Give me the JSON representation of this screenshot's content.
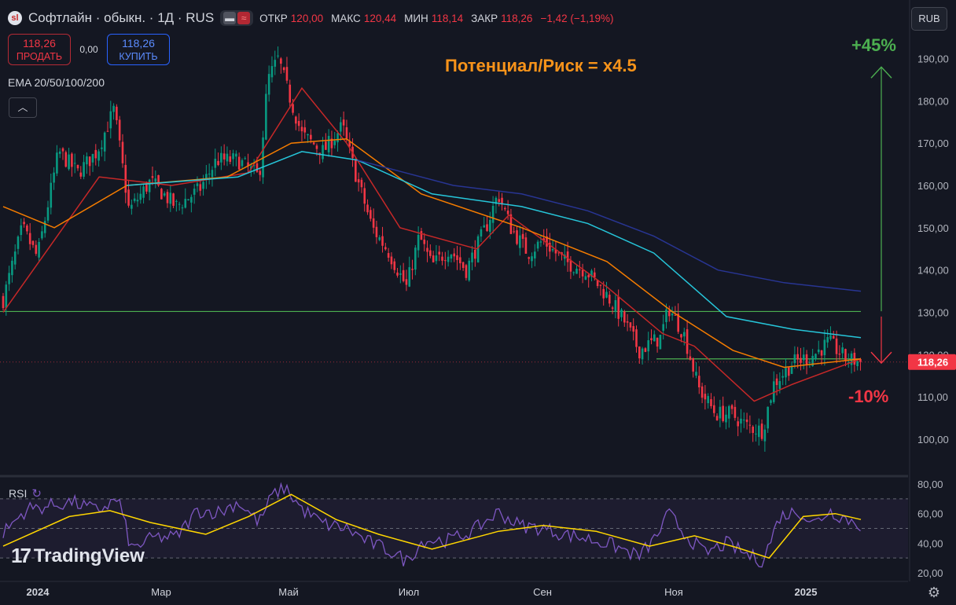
{
  "header": {
    "logo_text": "sl",
    "symbol": "Софтлайн · обыкн. · 1Д · RUS",
    "ohlc": [
      {
        "label": "ОТКР",
        "value": "120,00"
      },
      {
        "label": "МАКС",
        "value": "120,44"
      },
      {
        "label": "МИН",
        "value": "118,14"
      },
      {
        "label": "ЗАКР",
        "value": "118,26"
      },
      {
        "label": "",
        "value": "−1,42 (−1,19%)"
      }
    ],
    "currency": "RUB"
  },
  "trade": {
    "sell_price": "118,26",
    "sell_label": "ПРОДАТЬ",
    "spread": "0,00",
    "buy_price": "118,26",
    "buy_label": "КУПИТЬ"
  },
  "indicators": {
    "ema_label": "EMA 20/50/100/200",
    "rsi_label": "RSI"
  },
  "annotations": {
    "ratio": "Потенциал/Риск = x4.5",
    "upside": "+45%",
    "downside": "-10%"
  },
  "branding": {
    "name": "TradingView"
  },
  "colors": {
    "bg": "#141722",
    "up": "#089981",
    "down": "#f23645",
    "ema20": "#c62828",
    "ema50": "#f57c00",
    "ema100": "#26c6da",
    "ema200": "#283593",
    "level": "#4caf50",
    "rsi": "#7e57c2",
    "rsi_ma": "#ffd600",
    "annotation": "#f7931a"
  },
  "chart_data": {
    "type": "candlestick",
    "title": "Софтлайн · обыкн. · 1Д · RUS",
    "x_tick_labels": [
      "2024",
      "Мар",
      "Май",
      "Июл",
      "Сен",
      "Ноя",
      "2025"
    ],
    "y_tick_labels": [
      "190,00",
      "180,00",
      "170,00",
      "160,00",
      "150,00",
      "140,00",
      "130,00",
      "120,00",
      "110,00",
      "100,00"
    ],
    "ylim": [
      97,
      196
    ],
    "last_price": 118.26,
    "last_price_label": "118,26",
    "levels": [
      {
        "name": "resistance",
        "value": 130.2
      },
      {
        "name": "support",
        "value": 119.0
      }
    ],
    "targets": {
      "upside_arrow_to": 188,
      "downside_arrow_to": 118
    },
    "price_path": [
      [
        "2024-01-01",
        133
      ],
      [
        "2024-01-10",
        150
      ],
      [
        "2024-01-17",
        143
      ],
      [
        "2024-01-27",
        168
      ],
      [
        "2024-02-05",
        163
      ],
      [
        "2024-02-14",
        168
      ],
      [
        "2024-02-22",
        178
      ],
      [
        "2024-02-29",
        154
      ],
      [
        "2024-03-10",
        161
      ],
      [
        "2024-03-22",
        155
      ],
      [
        "2024-04-02",
        159
      ],
      [
        "2024-04-10",
        166
      ],
      [
        "2024-04-20",
        166
      ],
      [
        "2024-04-30",
        162
      ],
      [
        "2024-05-04",
        185
      ],
      [
        "2024-05-09",
        190
      ],
      [
        "2024-05-13",
        183
      ],
      [
        "2024-05-20",
        172
      ],
      [
        "2024-05-30",
        168
      ],
      [
        "2024-06-08",
        174
      ],
      [
        "2024-06-14",
        163
      ],
      [
        "2024-06-22",
        150
      ],
      [
        "2024-06-30",
        144
      ],
      [
        "2024-07-08",
        136
      ],
      [
        "2024-07-14",
        148
      ],
      [
        "2024-07-20",
        141
      ],
      [
        "2024-07-28",
        145
      ],
      [
        "2024-08-05",
        140
      ],
      [
        "2024-08-15",
        151
      ],
      [
        "2024-08-20",
        158
      ],
      [
        "2024-08-26",
        150
      ],
      [
        "2024-09-03",
        144
      ],
      [
        "2024-09-10",
        147
      ],
      [
        "2024-09-20",
        142
      ],
      [
        "2024-09-30",
        140
      ],
      [
        "2024-10-10",
        134
      ],
      [
        "2024-10-18",
        128
      ],
      [
        "2024-10-25",
        121
      ],
      [
        "2024-11-04",
        124
      ],
      [
        "2024-11-08",
        131
      ],
      [
        "2024-11-15",
        125
      ],
      [
        "2024-11-22",
        112
      ],
      [
        "2024-11-30",
        106
      ],
      [
        "2024-12-07",
        106
      ],
      [
        "2024-12-15",
        103
      ],
      [
        "2024-12-22",
        102
      ],
      [
        "2024-12-27",
        113
      ],
      [
        "2025-01-05",
        118
      ],
      [
        "2025-01-15",
        120
      ],
      [
        "2025-01-22",
        123
      ],
      [
        "2025-01-30",
        119
      ],
      [
        "2025-02-06",
        118.26
      ]
    ],
    "ema": {
      "ema20": [
        [
          "2024-01-01",
          130
        ],
        [
          "2024-02-15",
          162
        ],
        [
          "2024-03-20",
          160
        ],
        [
          "2024-04-25",
          163
        ],
        [
          "2024-05-20",
          183
        ],
        [
          "2024-06-10",
          170
        ],
        [
          "2024-07-05",
          150
        ],
        [
          "2024-08-10",
          145
        ],
        [
          "2024-08-25",
          153
        ],
        [
          "2024-10-10",
          136
        ],
        [
          "2024-11-05",
          125
        ],
        [
          "2024-11-20",
          122
        ],
        [
          "2024-12-18",
          109
        ],
        [
          "2025-01-05",
          113
        ],
        [
          "2025-02-06",
          119
        ]
      ],
      "ema50": [
        [
          "2024-01-01",
          155
        ],
        [
          "2024-01-25",
          150
        ],
        [
          "2024-02-28",
          160
        ],
        [
          "2024-04-15",
          162
        ],
        [
          "2024-05-15",
          170
        ],
        [
          "2024-06-10",
          171
        ],
        [
          "2024-07-15",
          158
        ],
        [
          "2024-08-31",
          150
        ],
        [
          "2024-10-10",
          142
        ],
        [
          "2024-11-10",
          130
        ],
        [
          "2024-12-08",
          121
        ],
        [
          "2025-01-01",
          117
        ],
        [
          "2025-02-06",
          119
        ]
      ],
      "ema100": [
        [
          "2024-02-28",
          160
        ],
        [
          "2024-04-20",
          162
        ],
        [
          "2024-05-20",
          168
        ],
        [
          "2024-06-15",
          166
        ],
        [
          "2024-07-20",
          158
        ],
        [
          "2024-08-31",
          155
        ],
        [
          "2024-10-01",
          151
        ],
        [
          "2024-11-01",
          144
        ],
        [
          "2024-12-05",
          129
        ],
        [
          "2025-01-05",
          126
        ],
        [
          "2025-02-06",
          124
        ]
      ],
      "ema200": [
        [
          "2024-06-15",
          166
        ],
        [
          "2024-07-30",
          160
        ],
        [
          "2024-08-31",
          158
        ],
        [
          "2024-10-01",
          154
        ],
        [
          "2024-11-01",
          148
        ],
        [
          "2024-12-01",
          140
        ],
        [
          "2025-01-01",
          137
        ],
        [
          "2025-02-06",
          135
        ]
      ]
    },
    "rsi": {
      "ylim": [
        20,
        80
      ],
      "y_tick_labels": [
        "80,00",
        "60,00",
        "40,00",
        "20,00"
      ],
      "bands": [
        70,
        50,
        30
      ],
      "rsi_path": [
        [
          "2024-01-01",
          47
        ],
        [
          "2024-01-12",
          63
        ],
        [
          "2024-01-22",
          65
        ],
        [
          "2024-02-02",
          68
        ],
        [
          "2024-02-14",
          62
        ],
        [
          "2024-02-24",
          70
        ],
        [
          "2024-03-01",
          36
        ],
        [
          "2024-03-12",
          44
        ],
        [
          "2024-03-22",
          44
        ],
        [
          "2024-04-01",
          62
        ],
        [
          "2024-04-12",
          61
        ],
        [
          "2024-04-20",
          68
        ],
        [
          "2024-04-30",
          54
        ],
        [
          "2024-05-06",
          72
        ],
        [
          "2024-05-12",
          78
        ],
        [
          "2024-05-20",
          63
        ],
        [
          "2024-05-30",
          53
        ],
        [
          "2024-06-10",
          50
        ],
        [
          "2024-06-20",
          41
        ],
        [
          "2024-06-30",
          35
        ],
        [
          "2024-07-08",
          28
        ],
        [
          "2024-07-16",
          42
        ],
        [
          "2024-07-28",
          42
        ],
        [
          "2024-08-08",
          48
        ],
        [
          "2024-08-20",
          61
        ],
        [
          "2024-08-30",
          52
        ],
        [
          "2024-09-10",
          50
        ],
        [
          "2024-09-20",
          46
        ],
        [
          "2024-10-01",
          43
        ],
        [
          "2024-10-12",
          39
        ],
        [
          "2024-10-25",
          31
        ],
        [
          "2024-11-02",
          44
        ],
        [
          "2024-11-08",
          60
        ],
        [
          "2024-11-15",
          47
        ],
        [
          "2024-11-25",
          33
        ],
        [
          "2024-12-05",
          40
        ],
        [
          "2024-12-15",
          32
        ],
        [
          "2024-12-22",
          28
        ],
        [
          "2024-12-30",
          58
        ],
        [
          "2025-01-08",
          62
        ],
        [
          "2025-01-15",
          53
        ],
        [
          "2025-01-22",
          62
        ],
        [
          "2025-02-06",
          52
        ]
      ],
      "rsi_ma": [
        [
          "2024-01-01",
          38
        ],
        [
          "2024-02-01",
          58
        ],
        [
          "2024-02-20",
          62
        ],
        [
          "2024-03-10",
          54
        ],
        [
          "2024-04-05",
          46
        ],
        [
          "2024-04-25",
          58
        ],
        [
          "2024-05-15",
          73
        ],
        [
          "2024-06-05",
          56
        ],
        [
          "2024-06-25",
          46
        ],
        [
          "2024-07-20",
          36
        ],
        [
          "2024-08-20",
          48
        ],
        [
          "2024-09-10",
          52
        ],
        [
          "2024-10-05",
          48
        ],
        [
          "2024-10-30",
          38
        ],
        [
          "2024-11-20",
          45
        ],
        [
          "2024-12-10",
          37
        ],
        [
          "2024-12-25",
          30
        ],
        [
          "2025-01-10",
          58
        ],
        [
          "2025-01-25",
          60
        ],
        [
          "2025-02-06",
          56
        ]
      ]
    }
  }
}
